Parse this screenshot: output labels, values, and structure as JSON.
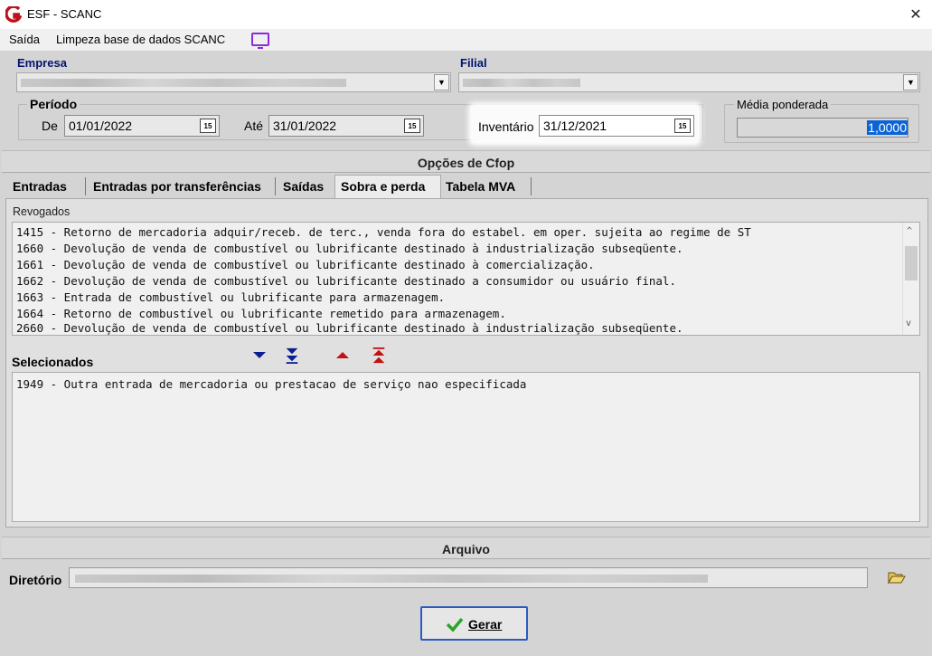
{
  "window": {
    "title": "ESF - SCANC",
    "close_glyph": "✕"
  },
  "menu": {
    "items": [
      "Saída",
      "Limpeza base de dados SCANC"
    ]
  },
  "empresa": {
    "label": "Empresa"
  },
  "filial": {
    "label": "Filial"
  },
  "periodo": {
    "label": "Período",
    "de_label": "De",
    "de_value": "01/01/2022",
    "ate_label": "Até",
    "ate_value": "31/01/2022"
  },
  "inventario": {
    "label": "Inventário",
    "value": "31/12/2021"
  },
  "media": {
    "label": "Média ponderada",
    "value": "1,0000"
  },
  "calendar_badge": "15",
  "cfop": {
    "header": "Opções de Cfop",
    "tabs": [
      "Entradas",
      "Entradas por transferências",
      "Saídas",
      "Sobra e perda",
      "Tabela MVA"
    ],
    "active_tab": "Sobra e perda",
    "revogados_label": "Revogados",
    "revogados": [
      "1415 - Retorno de mercadoria adquir/receb. de terc., venda fora do estabel. em oper. sujeita ao regime de ST",
      "1660 - Devolução de venda de combustível ou lubrificante destinado à industrialização subseqüente.",
      "1661 - Devolução de venda de combustível ou lubrificante destinado à comercialização.",
      "1662 - Devolução de venda de combustível ou lubrificante destinado a consumidor ou usuário final.",
      "1663 - Entrada de combustível ou lubrificante para armazenagem.",
      "1664 - Retorno de combustível ou lubrificante remetido para armazenagem.",
      "2660 - Devolução de venda de combustível ou lubrificante destinado à industrialização subseqüente."
    ],
    "selecionados_label": "Selecionados",
    "selecionados": [
      "1949 - Outra entrada de mercadoria ou prestacao de serviço nao especificada"
    ]
  },
  "arquivo": {
    "header": "Arquivo",
    "diretorio_label": "Diretório"
  },
  "gerar": {
    "label": "Gerar"
  },
  "colors": {
    "label_blue": "#00156e",
    "arrow_blue": "#0a1f8f",
    "arrow_red": "#c41010",
    "check_green": "#2aa52a",
    "logo_red": "#c0101a"
  }
}
